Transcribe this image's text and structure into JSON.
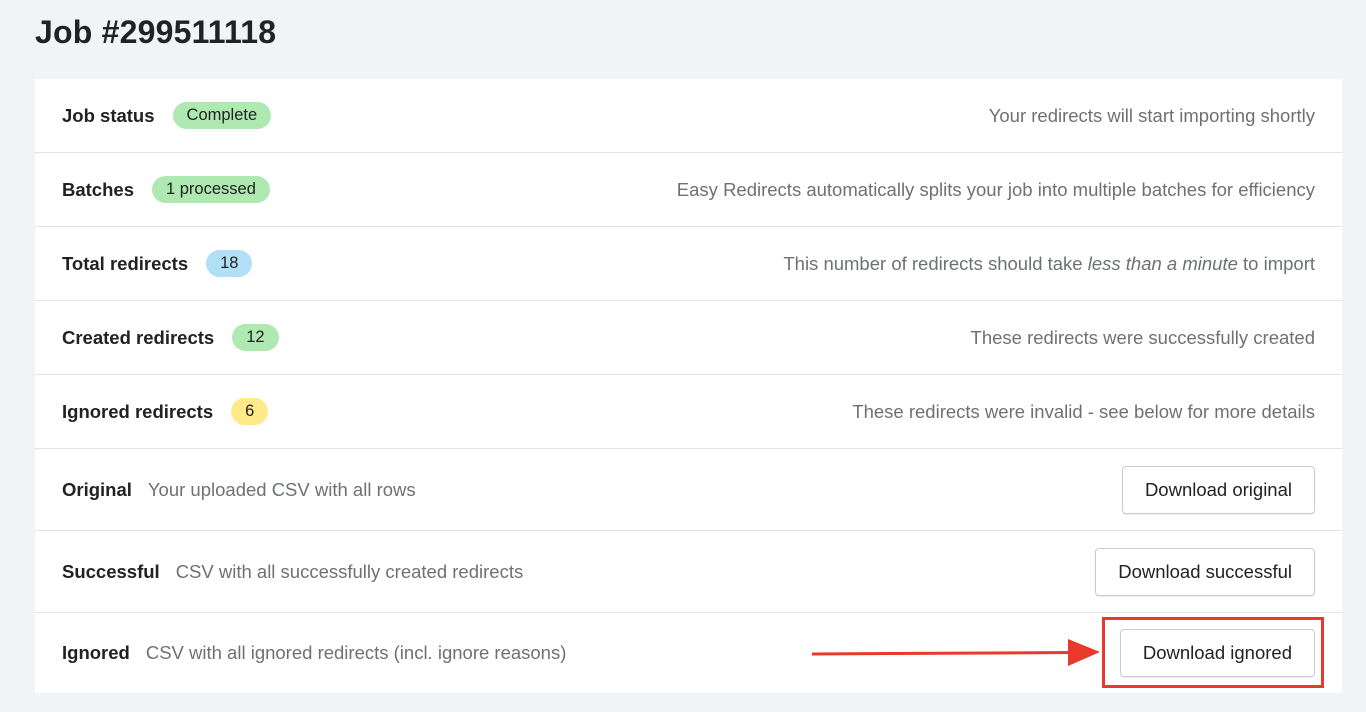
{
  "title": "Job #299511118",
  "rows": [
    {
      "label": "Job status",
      "badge": "Complete",
      "badge_color": "#aee9b1",
      "desc": "Your redirects will start importing shortly"
    },
    {
      "label": "Batches",
      "badge": "1 processed",
      "badge_color": "#aee9b1",
      "desc": "Easy Redirects automatically splits your job into multiple batches for efficiency"
    },
    {
      "label": "Total redirects",
      "badge": "18",
      "badge_color": "#b1dff5",
      "desc_before": "This number of redirects should take ",
      "desc_em": "less than a minute",
      "desc_after": " to import"
    },
    {
      "label": "Created redirects",
      "badge": "12",
      "badge_color": "#aee9b1",
      "desc": "These redirects were successfully created"
    },
    {
      "label": "Ignored redirects",
      "badge": "6",
      "badge_color": "#ffea8a",
      "desc": "These redirects were invalid - see below for more details"
    }
  ],
  "downloads": [
    {
      "label": "Original",
      "desc": "Your uploaded CSV with all rows",
      "button": "Download original"
    },
    {
      "label": "Successful",
      "desc": "CSV with all successfully created redirects",
      "button": "Download successful"
    },
    {
      "label": "Ignored",
      "desc": "CSV with all ignored redirects (incl. ignore reasons)",
      "button": "Download ignored"
    }
  ],
  "annotation": {
    "color": "#e8392a",
    "target": "Download ignored"
  }
}
